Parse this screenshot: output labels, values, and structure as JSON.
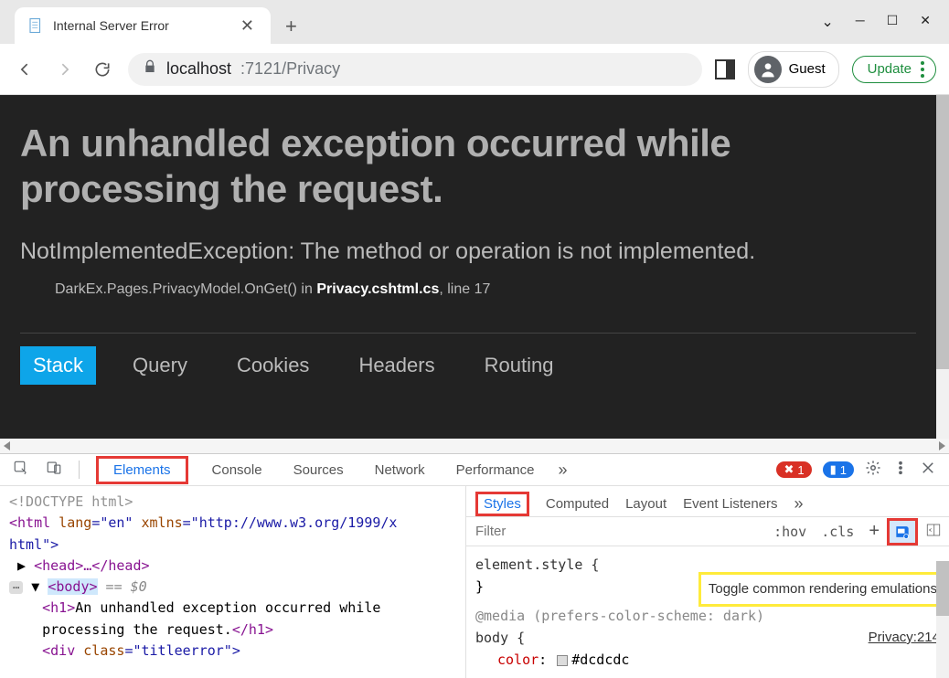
{
  "window": {
    "tab_title": "Internal Server Error",
    "guest_label": "Guest",
    "update_label": "Update"
  },
  "address": {
    "host_dark": "localhost",
    "host_rest": ":7121/Privacy"
  },
  "page": {
    "heading": "An unhandled exception occurred while processing the request.",
    "exception": "NotImplementedException: The method or operation is not implemented.",
    "source_prefix": "DarkEx.Pages.PrivacyModel.OnGet() in ",
    "source_file": "Privacy.cshtml.cs",
    "source_suffix": ", line 17",
    "tabs": [
      "Stack",
      "Query",
      "Cookies",
      "Headers",
      "Routing"
    ],
    "active_tab": 0
  },
  "devtools": {
    "tabs": [
      "Elements",
      "Console",
      "Sources",
      "Network",
      "Performance"
    ],
    "active_tab": 0,
    "error_count": "1",
    "issue_count": "1",
    "dom": {
      "doctype": "<!DOCTYPE html>",
      "html_open_1": "<html",
      "html_lang_attr": " lang",
      "html_lang_val": "=\"en\"",
      "html_xmlns_attr": " xmlns",
      "html_xmlns_val": "=\"http://www.w3.org/1999/x",
      "html_line2": "html\">",
      "head": "<head>…</head>",
      "body_open": "<body>",
      "eq0": " == $0",
      "h1_open": "<h1>",
      "h1_text": "An unhandled exception occurred while processing the request.",
      "h1_close": "</h1>",
      "div_open": "<div",
      "div_class_attr": " class",
      "div_class_val": "=\"titleerror\">"
    },
    "styles": {
      "tabs": [
        "Styles",
        "Computed",
        "Layout",
        "Event Listeners"
      ],
      "active_tab": 0,
      "filter_placeholder": "Filter",
      "hov_label": ":hov",
      "cls_label": ".cls",
      "tooltip": "Toggle common rendering emulations",
      "element_style": "element.style {",
      "close_brace": "}",
      "media": "@media (prefers-color-scheme: dark)",
      "body_sel": "body {",
      "link": "Privacy:214",
      "color_prop": "color",
      "color_val": "#dcdcdc"
    }
  }
}
